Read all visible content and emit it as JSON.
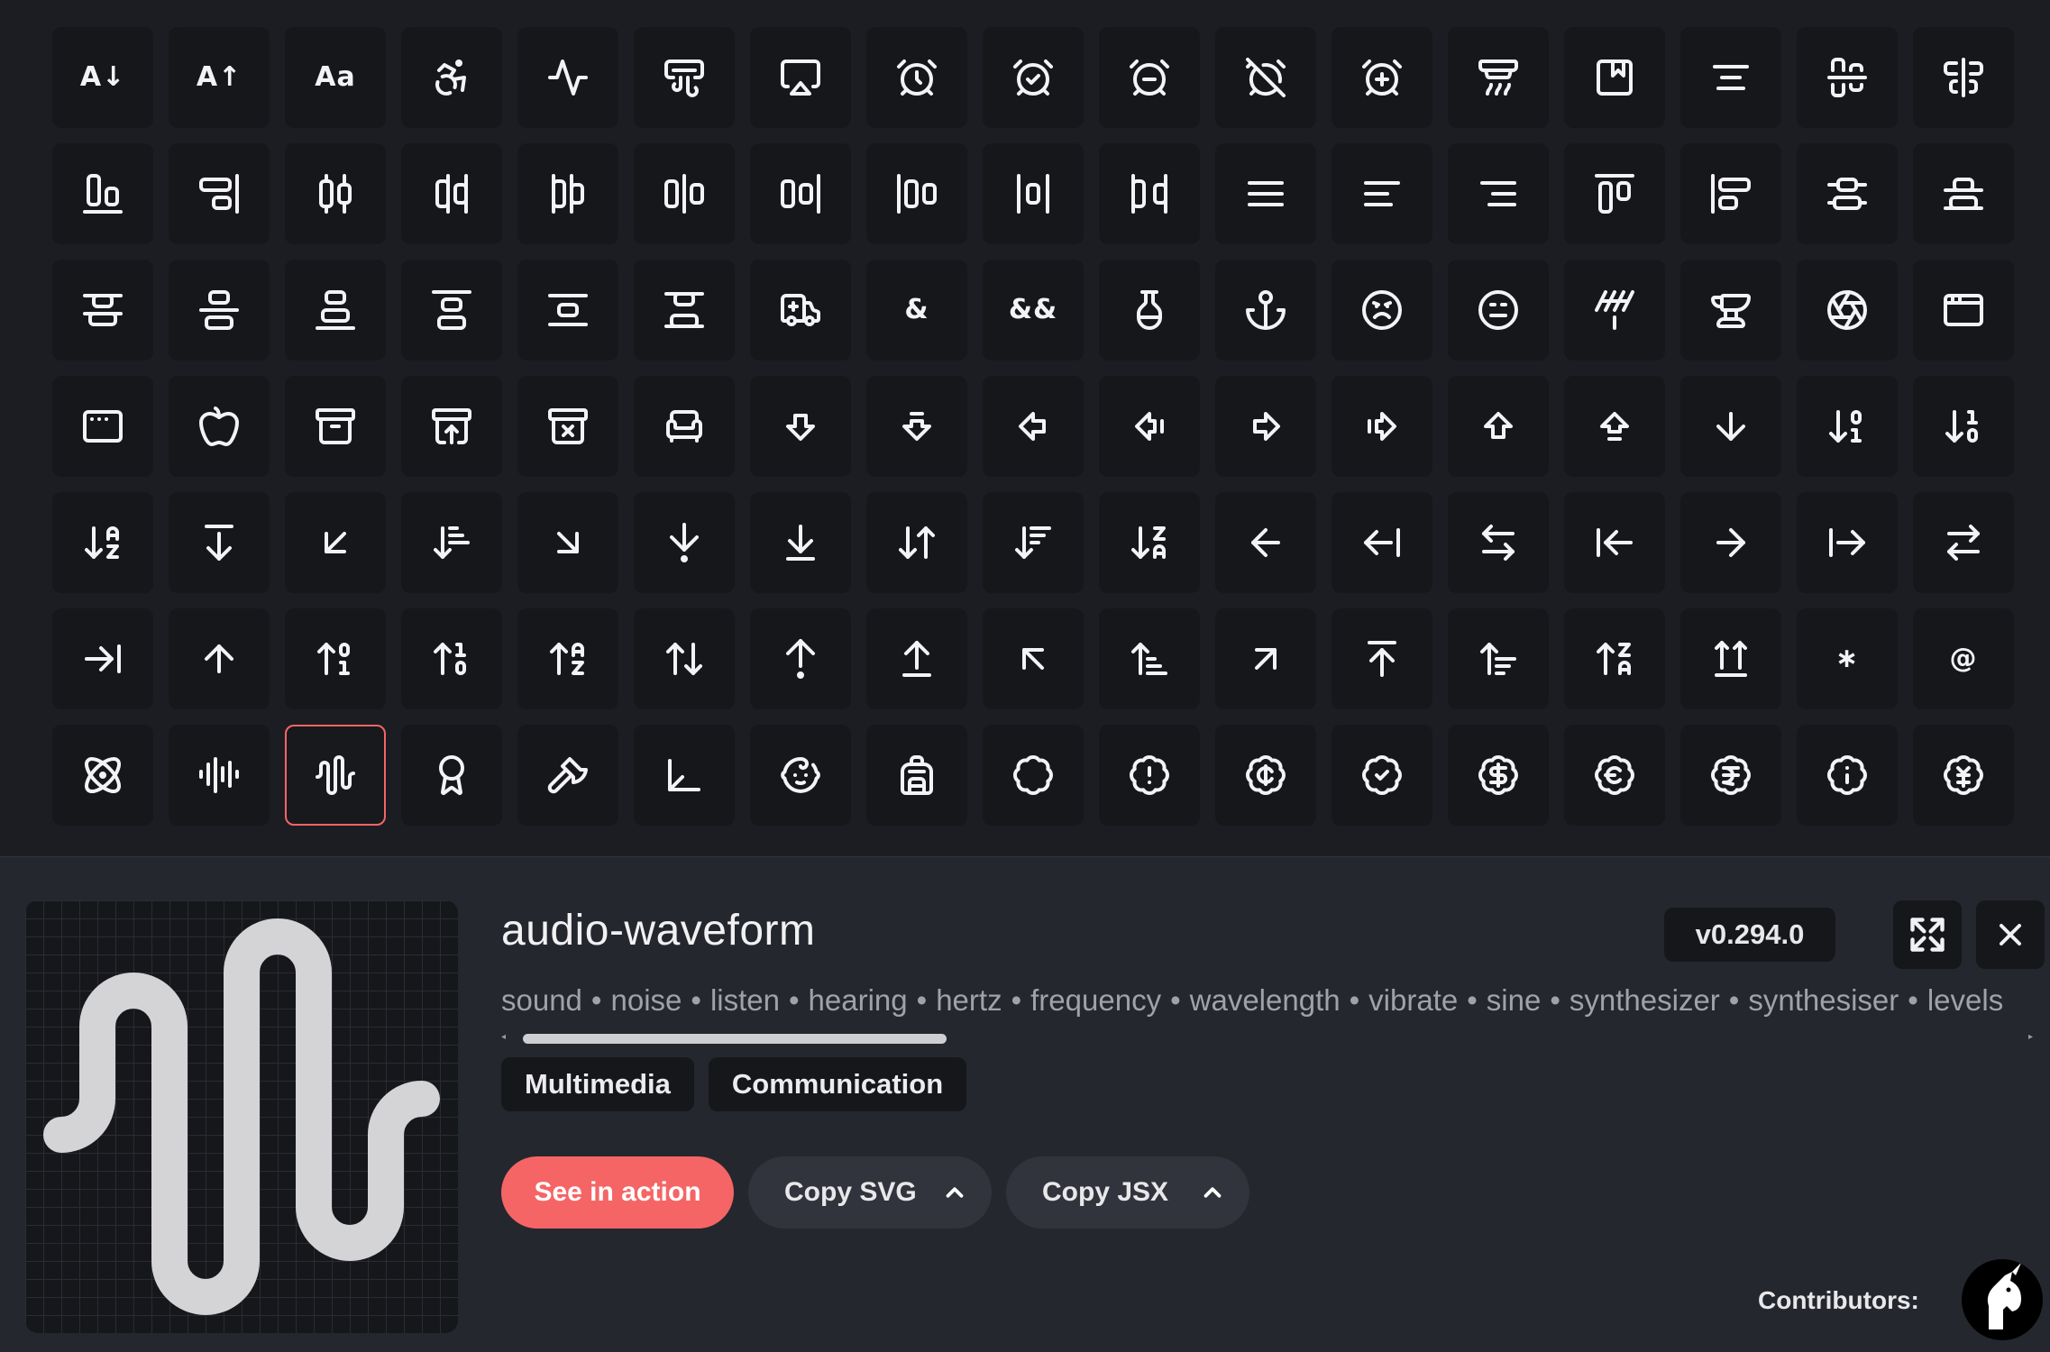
{
  "grid": {
    "rows": [
      [
        "arrow-down-a-z-caps",
        "arrow-up-a-z-caps",
        "case-sensitive",
        "accessibility",
        "activity",
        "air-vent",
        "airplay",
        "alarm-clock",
        "alarm-clock-check",
        "alarm-clock-minus",
        "alarm-clock-off",
        "alarm-clock-plus",
        "alarm-smoke",
        "album",
        "align-center",
        "align-center-horizontal",
        "align-center-vertical"
      ],
      [
        "align-end-horizontal",
        "align-end-vertical",
        "align-horizontal-distribute-center",
        "align-horizontal-distribute-end",
        "align-horizontal-distribute-start",
        "align-horizontal-justify-center",
        "align-horizontal-justify-end",
        "align-horizontal-justify-start",
        "align-horizontal-space-around",
        "align-horizontal-space-between",
        "align-justify",
        "align-left",
        "align-right",
        "align-start-horizontal",
        "align-start-vertical",
        "align-vertical-distribute-center",
        "align-vertical-distribute-end"
      ],
      [
        "align-vertical-distribute-start",
        "align-vertical-justify-center",
        "align-vertical-justify-end",
        "align-vertical-justify-start",
        "align-vertical-space-around",
        "align-vertical-space-between",
        "ambulance",
        "ampersand",
        "ampersands",
        "amphora",
        "anchor",
        "angry",
        "annoyed",
        "antenna",
        "anvil",
        "aperture",
        "app-window"
      ],
      [
        "app-window-mac",
        "apple",
        "archive",
        "archive-restore",
        "archive-x",
        "armchair",
        "arrow-big-down",
        "arrow-big-down-dash",
        "arrow-big-left",
        "arrow-big-left-dash",
        "arrow-big-right",
        "arrow-big-right-dash",
        "arrow-big-up",
        "arrow-big-up-dash",
        "arrow-down",
        "arrow-down-0-1",
        "arrow-down-1-0"
      ],
      [
        "arrow-down-a-z",
        "arrow-down-from-line",
        "arrow-down-left",
        "arrow-down-narrow-wide",
        "arrow-down-right",
        "arrow-down-to-dot",
        "arrow-down-to-line",
        "arrow-down-up",
        "arrow-down-wide-narrow",
        "arrow-down-z-a",
        "arrow-left",
        "arrow-left-from-line",
        "arrow-left-right",
        "arrow-left-to-line",
        "arrow-right",
        "arrow-right-from-line",
        "arrow-right-left"
      ],
      [
        "arrow-right-to-line",
        "arrow-up",
        "arrow-up-0-1",
        "arrow-up-1-0",
        "arrow-up-a-z",
        "arrow-up-down",
        "arrow-up-from-dot",
        "arrow-up-from-line",
        "arrow-up-left",
        "arrow-up-narrow-wide",
        "arrow-up-right",
        "arrow-up-to-line",
        "arrow-up-wide-narrow",
        "arrow-up-z-a",
        "arrows-up-from-line",
        "asterisk",
        "at-sign"
      ],
      [
        "atom",
        "audio-lines",
        "audio-waveform",
        "award",
        "axe",
        "axis-3d",
        "baby",
        "backpack",
        "badge",
        "badge-alert",
        "badge-cent",
        "badge-check",
        "badge-dollar-sign",
        "badge-euro",
        "badge-indian-rupee",
        "badge-info",
        "badge-japanese-yen"
      ]
    ],
    "text_glyphs": {
      "arrow-down-a-z-caps": "A↓",
      "arrow-up-a-z-caps": "A↑",
      "case-sensitive": "Aa",
      "ampersand": "&",
      "ampersands": "&&",
      "asterisk": "∗",
      "at-sign": "@"
    },
    "selected_icon": "audio-waveform",
    "colors": {
      "tile_bg": "#16171b",
      "icon_stroke": "#f3f3f5",
      "selected_border": "#f56565"
    }
  },
  "detail": {
    "icon_name": "audio-waveform",
    "version": "v0.294.0",
    "tags": [
      "sound",
      "noise",
      "listen",
      "hearing",
      "hertz",
      "frequency",
      "wavelength",
      "vibrate",
      "sine",
      "synthesizer",
      "synthesiser",
      "levels"
    ],
    "tag_separator": "•",
    "categories": [
      "Multimedia",
      "Communication"
    ],
    "actions": {
      "primary": "See in action",
      "copy_svg": "Copy SVG",
      "copy_jsx": "Copy JSX"
    },
    "contributors_label": "Contributors:",
    "icons": {
      "fullscreen": "expand-icon",
      "close": "x-icon",
      "dropdown": "chevron-up-icon"
    },
    "colors": {
      "accent": "#f56565",
      "drawer_bg": "#25272e",
      "secondary_btn": "#31343c"
    }
  }
}
